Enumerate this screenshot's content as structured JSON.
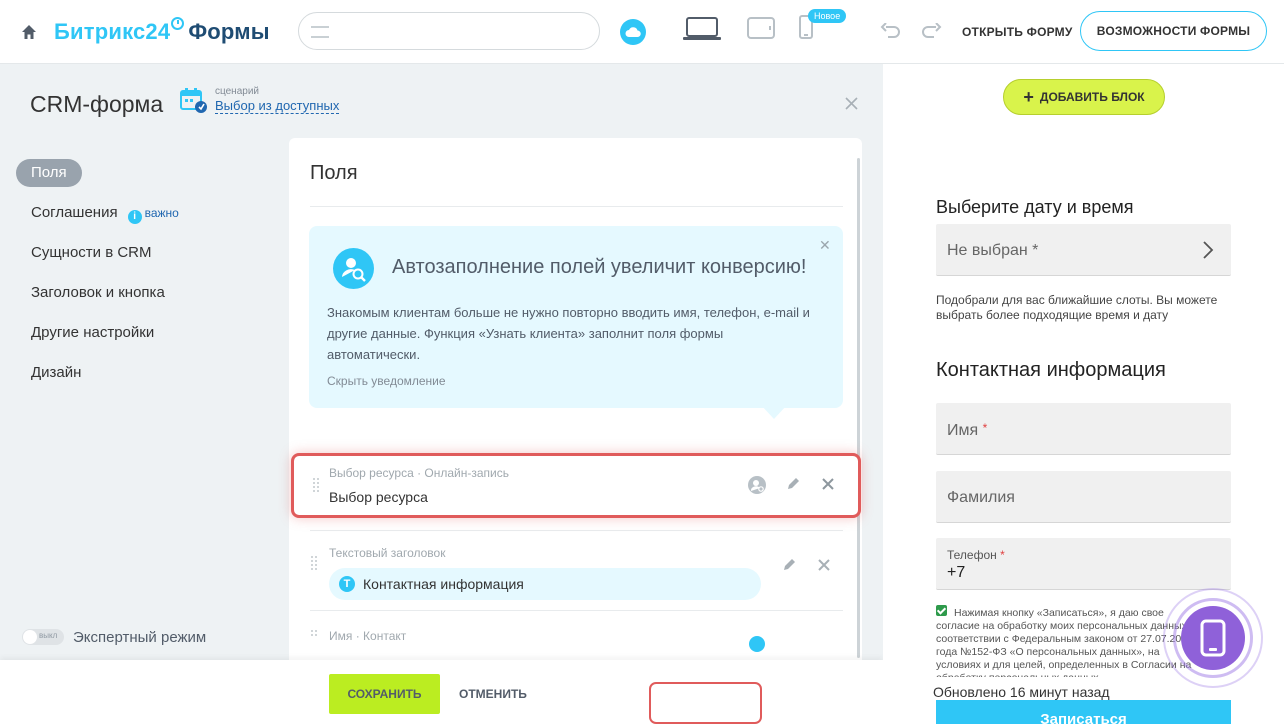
{
  "topbar": {
    "brand_main": "Битрикс24",
    "brand_product": "Формы",
    "new_badge": "Новое",
    "open_form": "ОТКРЫТЬ ФОРМУ",
    "features": "ВОЗМОЖНОСТИ ФОРМЫ"
  },
  "header": {
    "title": "CRM-форма",
    "scenario_caption": "сценарий",
    "scenario_link": "Выбор из доступных"
  },
  "sidebar": {
    "items": [
      {
        "label": "Поля"
      },
      {
        "label": "Соглашения",
        "badge": "важно"
      },
      {
        "label": "Сущности в CRM"
      },
      {
        "label": "Заголовок и кнопка"
      },
      {
        "label": "Другие настройки"
      },
      {
        "label": "Дизайн"
      }
    ],
    "expert_toggle": "выкл",
    "expert_label": "Экспертный режим"
  },
  "fields": {
    "title": "Поля",
    "notice": {
      "title": "Автозаполнение полей увеличит конверсию!",
      "text": "Знакомым клиентам больше не нужно повторно вводить имя, телефон, e-mail и другие данные. Функция «Узнать клиента» заполнит поля формы автоматически.",
      "hide": "Скрыть уведомление"
    },
    "rows": [
      {
        "caption": "Выбор ресурса · Онлайн-запись",
        "value": "Выбор ресурса"
      },
      {
        "caption": "Текстовый заголовок",
        "value": "Контактная информация"
      },
      {
        "caption": "Имя · Контакт",
        "value": ""
      }
    ]
  },
  "bottom": {
    "save": "СОХРАНИТЬ",
    "cancel": "ОТМЕНИТЬ"
  },
  "preview": {
    "add_block": "ДОБАВИТЬ БЛОК",
    "date_title": "Выберите дату и время",
    "date_placeholder": "Не выбран",
    "date_hint": "Подобрали для вас ближайшие слоты. Вы можете выбрать  более подходящие время и дату",
    "contact_title": "Контактная информация",
    "name_placeholder": "Имя",
    "surname_placeholder": "Фамилия",
    "phone_label": "Телефон",
    "phone_value": "+7",
    "consent": "Нажимая кнопку «Записаться», я даю свое согласие на обработку моих персональных данных, в соответствии с Федеральным законом от 27.07.2006 года №152-ФЗ «О персональных данных», на условиях и для целей, определенных в Согласии на обработку персональных данных",
    "updated": "Обновлено 16 минут назад",
    "submit": "Записаться"
  },
  "colors": {
    "accent": "#2fc6f6",
    "save": "#bbed21",
    "highlight": "#e05b5b"
  }
}
